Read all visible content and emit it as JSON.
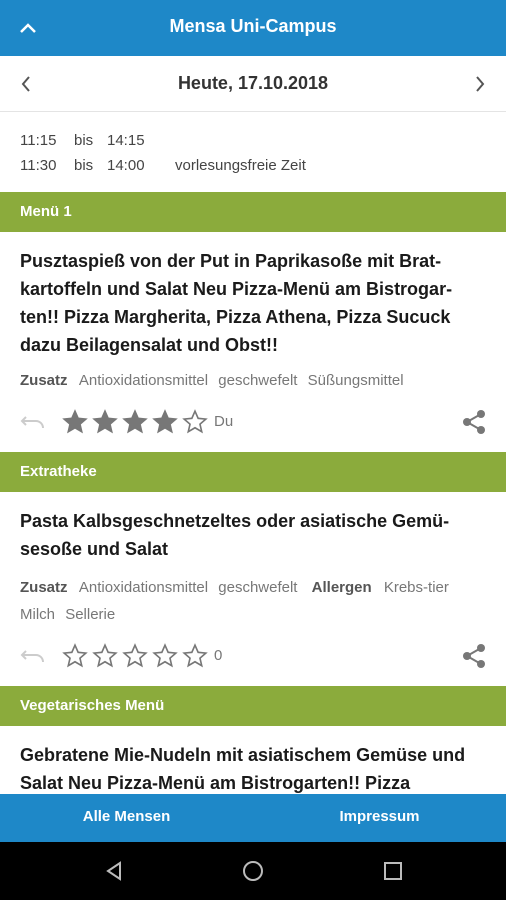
{
  "app": {
    "title": "Mensa Uni-Campus"
  },
  "date": {
    "label": "Heute, 17.10.2018"
  },
  "hours": [
    {
      "from": "11:15",
      "bis": "bis",
      "to": "14:15",
      "note": ""
    },
    {
      "from": "11:30",
      "bis": "bis",
      "to": "14:00",
      "note": "vorlesungsfreie Zeit"
    }
  ],
  "sections": [
    {
      "header": "Menü 1",
      "meal": "Pusztaspieß von der Put in Paprikasoße mit Brat-kartoffeln und Salat Neu Pizza-Menü am Bistrogar-ten!! Pizza Margherita, Pizza Athena, Pizza Sucuck dazu Beilagensalat und Obst!!",
      "zusatz_label": "Zusatz",
      "zusatz": [
        "Antioxidationsmittel",
        "geschwefelt",
        "Süßungsmittel"
      ],
      "allergen_label": "",
      "allergen": [],
      "rating": 4,
      "score_text": "Du"
    },
    {
      "header": "Extratheke",
      "meal": "Pasta Kalbsgeschnetzeltes oder asiatische Gemü-sesoße und Salat",
      "zusatz_label": "Zusatz",
      "zusatz": [
        "Antioxidationsmittel",
        "geschwefelt"
      ],
      "allergen_label": "Allergen",
      "allergen": [
        "Krebs-tier",
        "Milch",
        "Sellerie"
      ],
      "rating": 0,
      "score_text": "0"
    },
    {
      "header": "Vegetarisches Menü",
      "meal": "Gebratene Mie-Nudeln mit asiatischem Gemüse und Salat Neu Pizza-Menü am Bistrogarten!! Pizza"
    }
  ],
  "bottom_nav": {
    "all": "Alle Mensen",
    "impressum": "Impressum"
  },
  "colors": {
    "primary": "#1e88c8",
    "section": "#8bab3c"
  },
  "icons": {
    "up": "chevron-up-icon",
    "prev": "chevron-left-icon",
    "next": "chevron-right-icon",
    "undo": "undo-icon",
    "star": "star-icon",
    "share": "share-icon"
  }
}
